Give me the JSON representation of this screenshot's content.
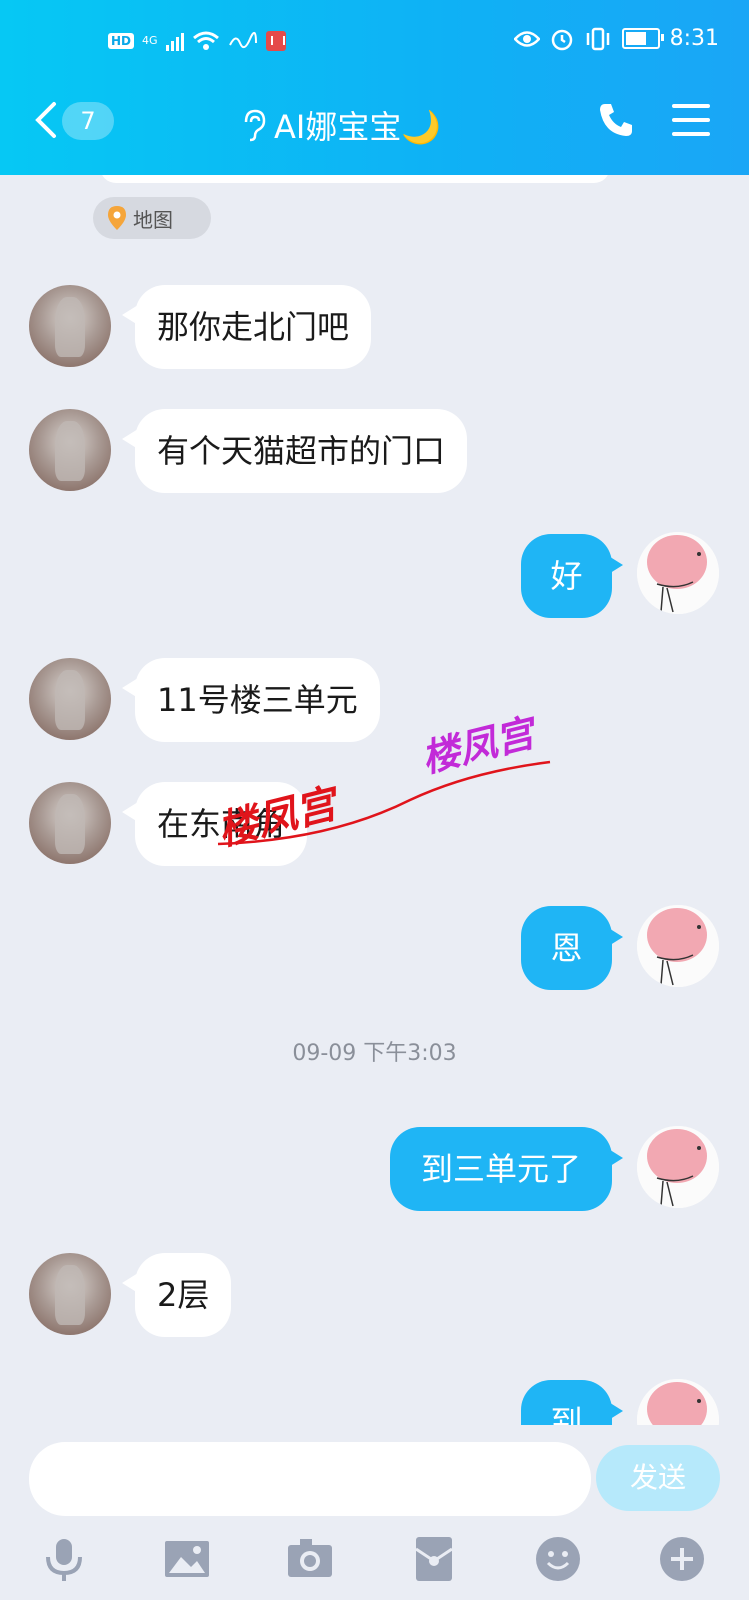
{
  "status_bar": {
    "hd": "HD",
    "network": "4G",
    "time": "8:31",
    "icons": [
      "signal-icon",
      "wifi-icon",
      "book-icon",
      "eye-icon",
      "alarm-icon",
      "vibrate-icon",
      "battery-icon"
    ]
  },
  "header": {
    "back_count": "7",
    "title": "AI娜宝宝🌙",
    "title_icon": "ear-icon"
  },
  "chat": {
    "map_label": "地图",
    "messages": [
      {
        "side": "in",
        "text": "那你走北门吧"
      },
      {
        "side": "in",
        "text": "有个天猫超市的门口"
      },
      {
        "side": "out",
        "text": "好"
      },
      {
        "side": "in",
        "text": "11号楼三单元"
      },
      {
        "side": "in",
        "text": "在东南角"
      },
      {
        "side": "out",
        "text": "恩"
      },
      {
        "side": "out",
        "text": "到三单元了"
      },
      {
        "side": "in",
        "text": "2层"
      },
      {
        "side": "out",
        "text": "到"
      }
    ],
    "timestamp": "09-09 下午3:03"
  },
  "watermark": {
    "text1": "楼凤宫",
    "text2": "楼凤宫",
    "color1": "#e0141b",
    "color2": "#c22ad8"
  },
  "input_bar": {
    "placeholder": "",
    "send_label": "发送",
    "tools": [
      "microphone-icon",
      "image-icon",
      "camera-icon",
      "red-packet-icon",
      "emoji-icon",
      "plus-icon"
    ]
  },
  "colors": {
    "accent": "#1fb5f5",
    "background": "#eaedf4"
  }
}
